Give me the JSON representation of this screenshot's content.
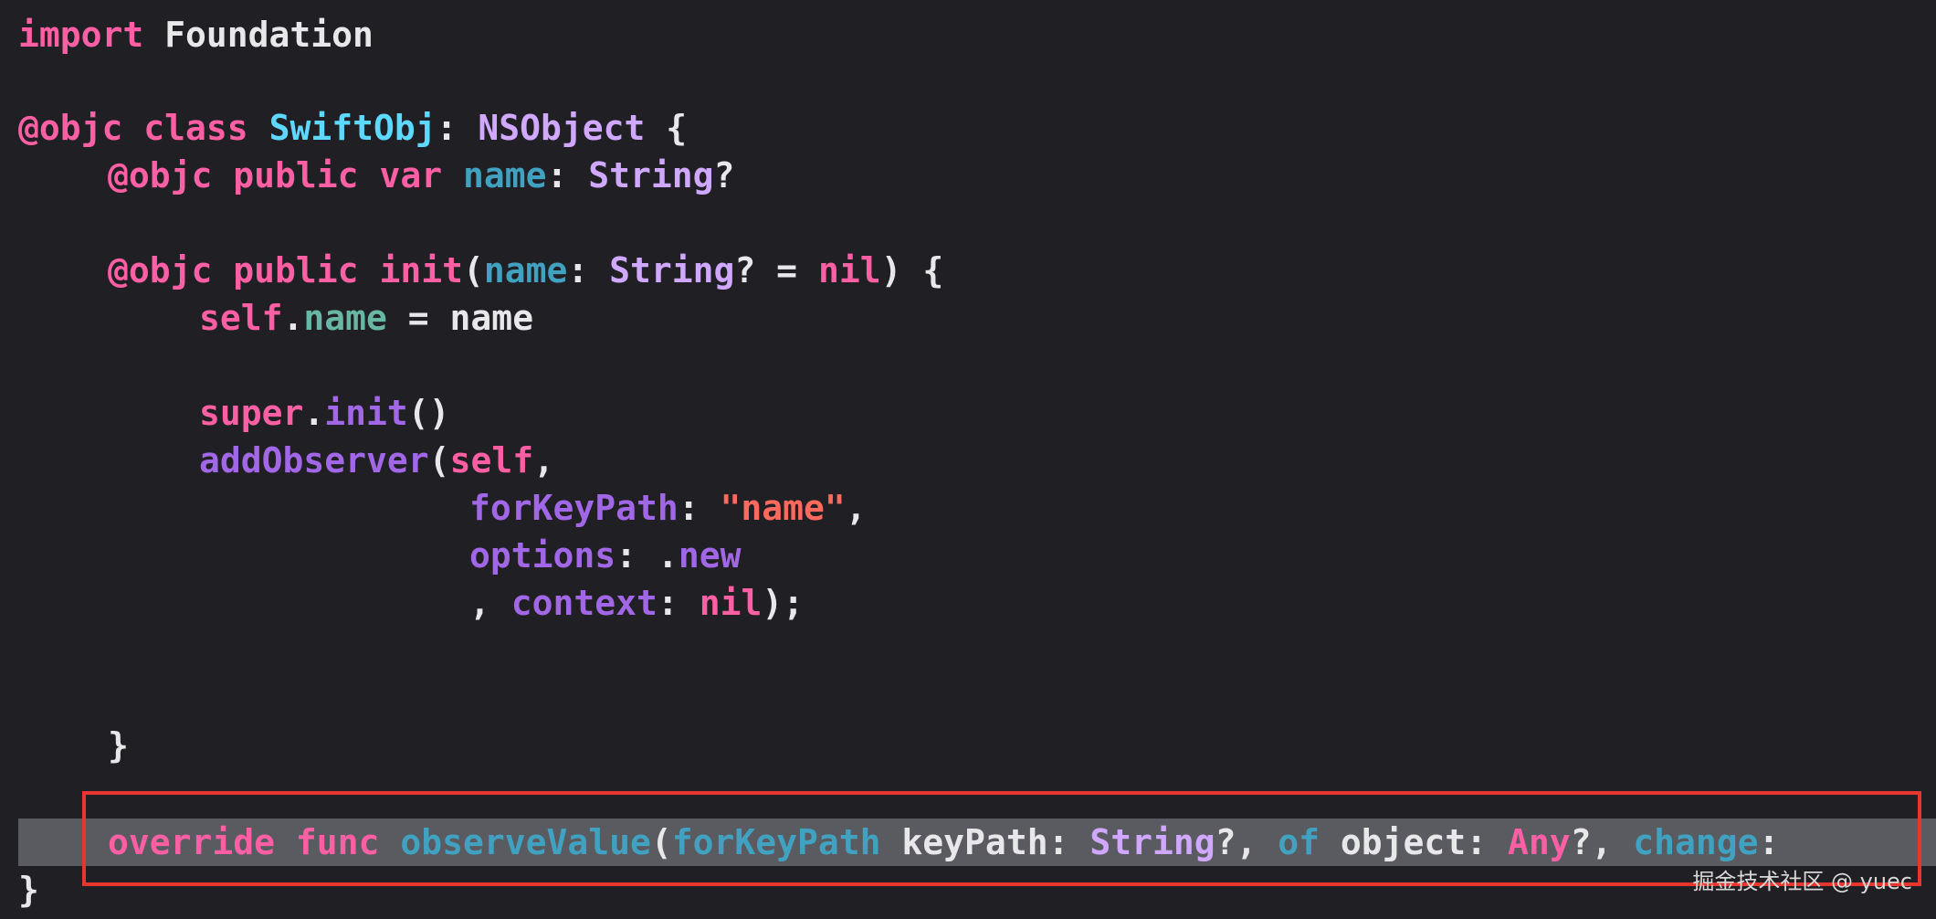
{
  "editor": {
    "lines": {
      "l1": {
        "kw": "import",
        "rest": " Foundation"
      },
      "l3": {
        "at": "@objc",
        "cls": "class",
        "name": "SwiftObj",
        "colon": ": ",
        "base": "NSObject",
        "brace": " {"
      },
      "l4": {
        "at": "@objc",
        "pub": "public",
        "var": "var",
        "prop": "name",
        "colon": ": ",
        "type": "String",
        "q": "?"
      },
      "l6": {
        "at": "@objc",
        "pub": "public",
        "init": "init",
        "lp": "(",
        "param": "name",
        "colon": ": ",
        "type": "String",
        "q": "? = ",
        "nil": "nil",
        "rp": ") {"
      },
      "l7": {
        "self": "self",
        "dot": ".",
        "member": "name",
        "rest": " = name"
      },
      "l9": {
        "super": "super",
        "dot": ".",
        "init": "init",
        "rest": "()"
      },
      "l10": {
        "fn": "addObserver",
        "lp": "(",
        "self": "self",
        "comma": ","
      },
      "l11": {
        "label": "forKeyPath",
        "colon": ": ",
        "str": "\"name\"",
        "comma": ","
      },
      "l12": {
        "label": "options",
        "colon": ": ",
        "dot": ".",
        "member": "new"
      },
      "l13": {
        "comma": ", ",
        "label": "context",
        "colon": ": ",
        "nil": "nil",
        "end": ");"
      },
      "l16": {
        "brace": "}"
      },
      "l18": {
        "override": "override",
        "func": "func",
        "name": "observeValue",
        "lp": "(",
        "label1": "forKeyPath",
        "p1": " keyPath",
        "c1": ": ",
        "t1": "String",
        "q1": "?, ",
        "label2": "of",
        "p2": " object",
        "c2": ": ",
        "t2": "Any",
        "q2": "?, ",
        "label3": "change",
        "c3": ":"
      },
      "l19": {
        "brace": "}"
      }
    },
    "colors": {
      "background": "#1f1f24",
      "keyword": "#fc5fa3",
      "type": "#d0a8ff",
      "declared_type": "#5dd8ff",
      "param": "#41a1c0",
      "member": "#67b7a4",
      "method": "#a167e6",
      "string": "#fc6a5d",
      "highlight_box": "#e8352d"
    }
  },
  "watermark": "掘金技术社区 @ yuec"
}
